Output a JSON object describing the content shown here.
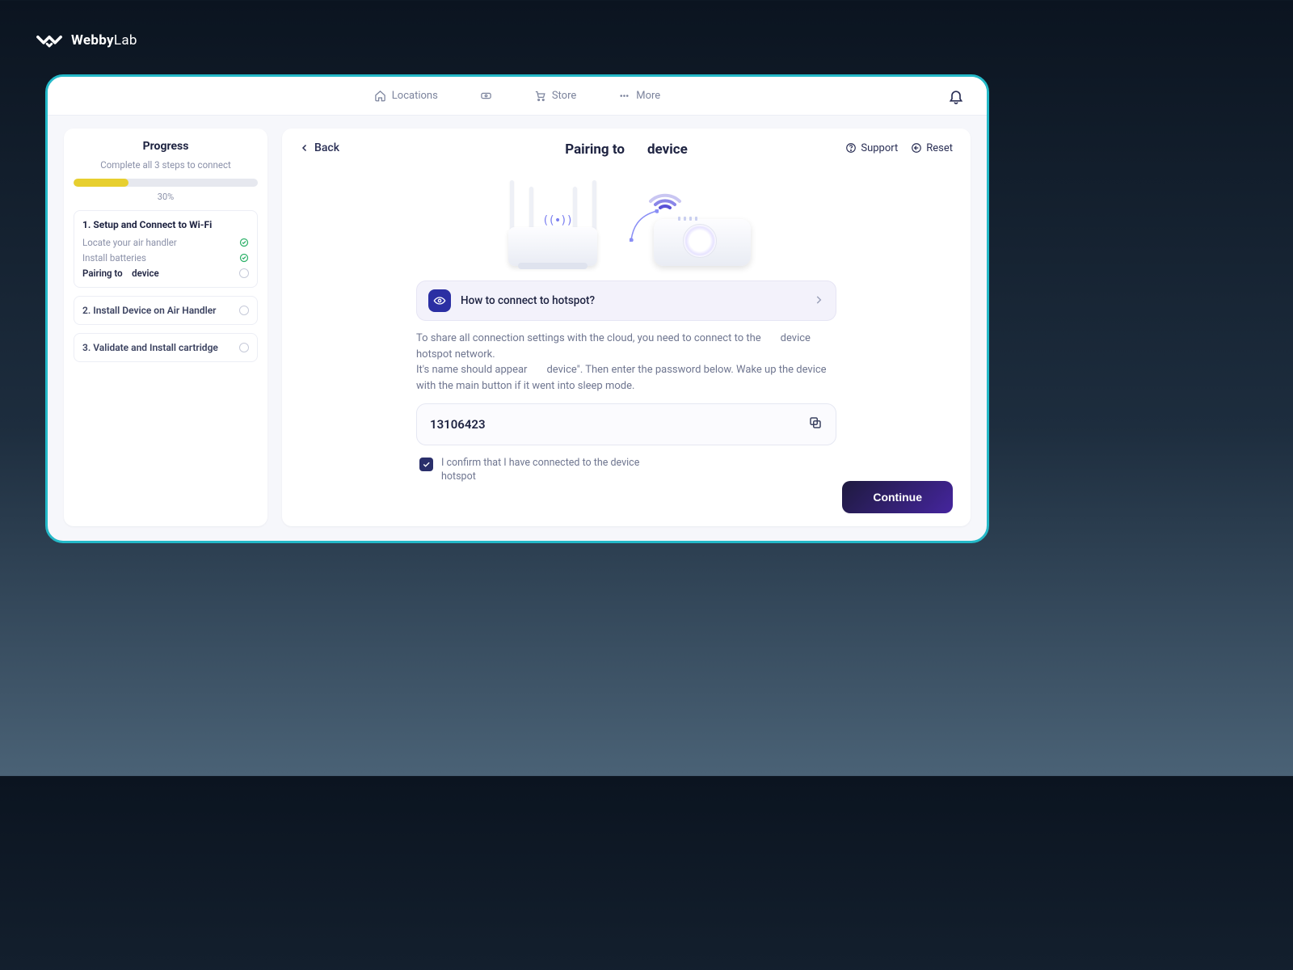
{
  "brand": {
    "name_a": "Webby",
    "name_b": "Lab"
  },
  "nav": {
    "locations": "Locations",
    "store": "Store",
    "more": "More"
  },
  "sidebar": {
    "title": "Progress",
    "subtitle": "Complete all 3 steps to connect",
    "percent_text": "30%",
    "percent": 30,
    "step1": {
      "title": "1. Setup and Connect to Wi-Fi",
      "sub_a": "Locate your air handler",
      "sub_b": "Install batteries",
      "sub_c_a": "Pairing to",
      "sub_c_b": "device"
    },
    "step2": "2. Install Device on Air Handler",
    "step3": "3. Validate and Install cartridge"
  },
  "main": {
    "back": "Back",
    "title_a": "Pairing to",
    "title_b": "device",
    "support": "Support",
    "reset": "Reset",
    "help_card": "How to connect to hotspot?",
    "desc_line1": "To share all connection settings with the cloud, you need to connect to the",
    "desc_line1b": "device hotspot network.",
    "desc_line2a": "It's name should appear",
    "desc_line2b": "device\". Then enter the password below. Wake up the device with the main button if it went into sleep mode.",
    "code": "13106423",
    "confirm": "I confirm that I have connected to the device hotspot",
    "continue": "Continue"
  }
}
